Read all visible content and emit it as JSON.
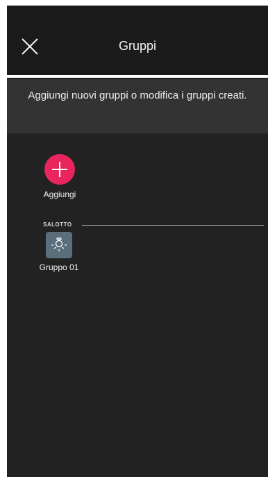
{
  "header": {
    "title": "Gruppi",
    "close_icon": "close-icon"
  },
  "info": {
    "text": "Aggiungi nuovi gruppi o modifica i gruppi creati."
  },
  "add": {
    "label": "Aggiungi",
    "icon": "plus-icon",
    "color": "#e8255d"
  },
  "section": {
    "label": "SALOTTO"
  },
  "groups": [
    {
      "label": "Gruppo 01",
      "icon": "light-bulb-icon",
      "color": "#5a6e7c"
    }
  ],
  "colors": {
    "background": "#222222",
    "header": "#1b1b1b",
    "banner": "#333333",
    "accent": "#e8255d"
  }
}
